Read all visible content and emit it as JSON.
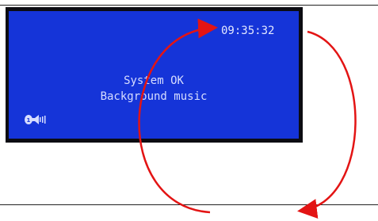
{
  "display": {
    "time": "09:35:32",
    "status_line_1": "System OK",
    "status_line_2": "Background music",
    "icon": "music-speaker-icon"
  },
  "colors": {
    "screen": "#1534d8",
    "frame": "#0c0c12",
    "text": "#d7ddff",
    "annotation_arrow": "#e31414"
  }
}
